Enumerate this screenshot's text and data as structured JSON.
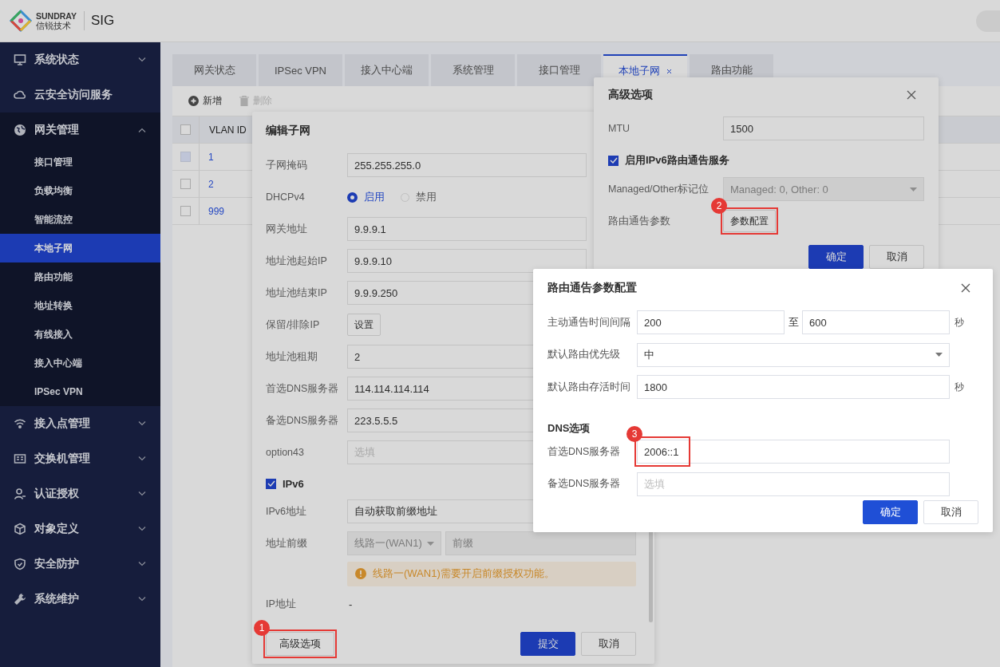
{
  "header": {
    "brand_en": "SUNDRAY",
    "brand_cn": "信锐技术",
    "product": "SIG"
  },
  "sidebar": {
    "items": [
      {
        "label": "系统状态",
        "kind": "group",
        "expanded": false
      },
      {
        "label": "云安全访问服务",
        "kind": "link"
      },
      {
        "label": "网关管理",
        "kind": "group",
        "expanded": true,
        "children": [
          {
            "label": "接口管理",
            "selected": false
          },
          {
            "label": "负载均衡",
            "selected": false
          },
          {
            "label": "智能流控",
            "selected": false
          },
          {
            "label": "本地子网",
            "selected": true
          },
          {
            "label": "路由功能",
            "selected": false
          },
          {
            "label": "地址转换",
            "selected": false
          },
          {
            "label": "有线接入",
            "selected": false
          },
          {
            "label": "接入中心端",
            "selected": false
          },
          {
            "label": "IPSec VPN",
            "selected": false
          }
        ]
      },
      {
        "label": "接入点管理",
        "kind": "group",
        "expanded": false
      },
      {
        "label": "交换机管理",
        "kind": "group",
        "expanded": false
      },
      {
        "label": "认证授权",
        "kind": "group",
        "expanded": false
      },
      {
        "label": "对象定义",
        "kind": "group",
        "expanded": false
      },
      {
        "label": "安全防护",
        "kind": "group",
        "expanded": false
      },
      {
        "label": "系统维护",
        "kind": "group",
        "expanded": false
      }
    ]
  },
  "tabs": [
    {
      "label": "网关状态",
      "selected": false,
      "closable": false
    },
    {
      "label": "IPSec VPN",
      "selected": false,
      "closable": false
    },
    {
      "label": "接入中心端",
      "selected": false,
      "closable": false
    },
    {
      "label": "系统管理",
      "selected": false,
      "closable": false
    },
    {
      "label": "接口管理",
      "selected": false,
      "closable": false
    },
    {
      "label": "本地子网",
      "selected": true,
      "closable": true
    },
    {
      "label": "路由功能",
      "selected": false,
      "closable": false
    }
  ],
  "toolbar": [
    {
      "label": "新增",
      "disabled": false
    },
    {
      "label": "删除",
      "disabled": true
    }
  ],
  "table": {
    "select_all_checked": false,
    "columns": [
      "VLAN ID"
    ],
    "rows": [
      {
        "vlan_id": "1",
        "checked": false,
        "disabled": true
      },
      {
        "vlan_id": "2",
        "checked": false,
        "disabled": false
      },
      {
        "vlan_id": "999",
        "checked": false,
        "disabled": false
      }
    ]
  },
  "edit_dialog": {
    "title": "编辑子网",
    "rows": [
      {
        "kind": "input",
        "label": "子网掩码",
        "value": "255.255.255.0"
      },
      {
        "kind": "radio",
        "label": "DHCPv4",
        "options": [
          {
            "label": "启用",
            "selected": true
          },
          {
            "label": "禁用",
            "selected": false
          }
        ]
      },
      {
        "kind": "input",
        "label": "网关地址",
        "value": "9.9.9.1"
      },
      {
        "kind": "input",
        "label": "地址池起始IP",
        "value": "9.9.9.10"
      },
      {
        "kind": "input",
        "label": "地址池结束IP",
        "value": "9.9.9.250"
      },
      {
        "kind": "button",
        "label": "保留/排除IP",
        "button": "设置"
      },
      {
        "kind": "input",
        "label": "地址池租期",
        "value": "2"
      },
      {
        "kind": "input",
        "label": "首选DNS服务器",
        "value": "114.114.114.114"
      },
      {
        "kind": "input",
        "label": "备选DNS服务器",
        "value": "223.5.5.5"
      },
      {
        "kind": "input",
        "label": "option43",
        "placeholder": "选填"
      },
      {
        "kind": "check",
        "label": "IPv6",
        "checked": true
      },
      {
        "kind": "input",
        "label": "IPv6地址",
        "value": "自动获取前缀地址"
      },
      {
        "kind": "prefix",
        "label": "地址前缀",
        "select": "线路一(WAN1)",
        "placeholder": "前缀"
      },
      {
        "kind": "notice",
        "text": "线路一(WAN1)需要开启前缀授权功能。"
      },
      {
        "kind": "text",
        "label": "IP地址",
        "value": "-"
      }
    ],
    "buttons": [
      {
        "label": "高级选项",
        "kind": "extra",
        "callout": "1"
      },
      {
        "label": "提交",
        "kind": "primary"
      },
      {
        "label": "取消",
        "kind": "default"
      }
    ]
  },
  "advanced_dialog": {
    "title": "高级选项",
    "rows": [
      {
        "kind": "input",
        "label": "MTU",
        "value": "1500"
      },
      {
        "kind": "check",
        "label": "启用IPv6路由通告服务",
        "checked": true
      },
      {
        "kind": "select",
        "label": "Managed/Other标记位",
        "value": "Managed: 0, Other: 0",
        "disabled": true
      },
      {
        "kind": "button",
        "label": "路由通告参数",
        "button": "参数配置",
        "callout": "2"
      }
    ],
    "buttons": [
      {
        "label": "确定",
        "kind": "primary"
      },
      {
        "label": "取消",
        "kind": "default"
      }
    ]
  },
  "ra_dialog": {
    "title": "路由通告参数配置",
    "rows": [
      {
        "kind": "range",
        "label": "主动通告时间间隔",
        "from": "200",
        "separator": "至",
        "to": "600",
        "unit": "秒"
      },
      {
        "kind": "select",
        "label": "默认路由优先级",
        "value": "中",
        "disabled": false
      },
      {
        "kind": "input",
        "label": "默认路由存活时间",
        "value": "1800",
        "unit": "秒"
      },
      {
        "kind": "section",
        "label": "DNS选项"
      },
      {
        "kind": "input",
        "label": "首选DNS服务器",
        "value": "2006::1",
        "callout": "3"
      },
      {
        "kind": "input",
        "label": "备选DNS服务器",
        "placeholder": "选填"
      }
    ],
    "buttons": [
      {
        "label": "确定",
        "kind": "primary"
      },
      {
        "label": "取消",
        "kind": "default"
      }
    ]
  }
}
